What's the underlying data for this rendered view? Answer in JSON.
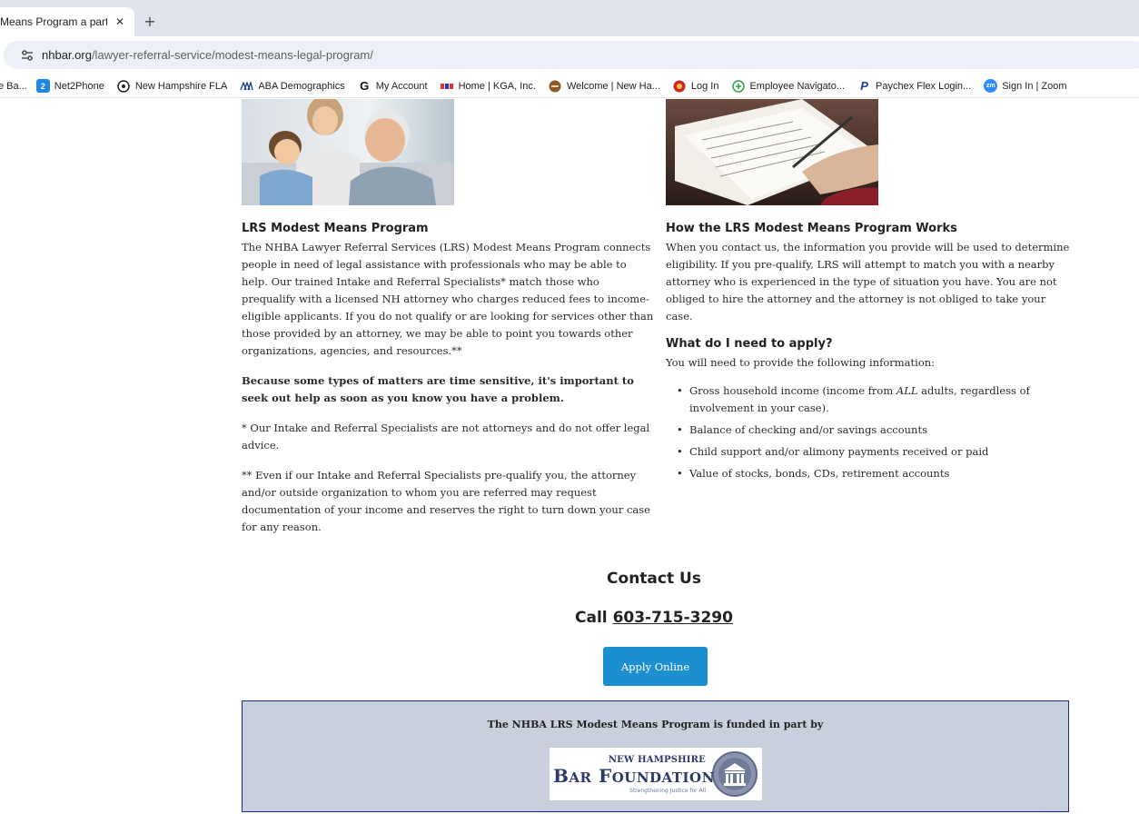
{
  "browser": {
    "tab_title": "Means Program a part",
    "tab_close": "✕",
    "new_tab": "+",
    "url_host": "nhbar.org",
    "url_path": "/lawyer-referral-service/modest-means-legal-program/"
  },
  "bookmarks": [
    {
      "label": "e Ba...",
      "icon": "none"
    },
    {
      "label": "Net2Phone",
      "icon": "2",
      "color": "#1e88e5"
    },
    {
      "label": "New Hampshire FLA",
      "icon": "circle-logo-icon"
    },
    {
      "label": "ABA Demographics",
      "icon": "aba-logo-icon"
    },
    {
      "label": "My Account",
      "icon": "G",
      "color": "#1a1a1a"
    },
    {
      "label": "Home | KGA, Inc.",
      "icon": "kga-logo-icon"
    },
    {
      "label": "Welcome | New Ha...",
      "icon": "brown-circle-icon"
    },
    {
      "label": "Log In",
      "icon": "red-circle-icon"
    },
    {
      "label": "Employee Navigato...",
      "icon": "green-plus-icon"
    },
    {
      "label": "Paychex Flex Login...",
      "icon": "P"
    },
    {
      "label": "Sign In | Zoom",
      "icon": "zm"
    }
  ],
  "left": {
    "heading": "LRS Modest Means Program",
    "para1": "The NHBA Lawyer Referral Services (LRS) Modest Means Program connects people in need of legal assistance with professionals who may be able to help. Our trained Intake and Referral Specialists* match those who prequalify with a licensed NH attorney who charges reduced fees to income-eligible applicants. If you do not qualify or are looking for services other than those provided by an attorney, we may be able to point you towards other organizations, agencies, and resources.**",
    "para2": "Because some types of matters are time sensitive, it's important to seek out help as soon as you know you have a problem.",
    "para3": "* Our Intake and Referral Specialists are not attorneys and do not offer legal advice.",
    "para4": "** Even if our Intake and Referral Specialists pre-qualify you, the attorney and/or outside organization to whom you are referred may request documentation of your income and reserves the right to turn down your case for any reason."
  },
  "right": {
    "heading": "How the LRS Modest Means Program Works",
    "para1": "When you contact us, the information you provide will be used to determine eligibility. If you pre-qualify, LRS will attempt to match you with a nearby attorney who is experienced in the type of situation you have. You are not obliged to hire the attorney and the attorney is not obliged to take your case.",
    "heading2": "What do I need to apply?",
    "para2": "You will need to provide the following information:",
    "item1_pre": "Gross household income (income from ",
    "item1_em": "ALL",
    "item1_post": " adults, regardless of involvement in your case).",
    "item2": "Balance of checking and/or savings accounts",
    "item3": "Child support and/or alimony payments received or paid",
    "item4": "Value of stocks, bonds, CDs, retirement accounts"
  },
  "contact": {
    "title": "Contact Us",
    "call_prefix": "Call ",
    "phone": "603-715-3290",
    "apply_label": "Apply Online"
  },
  "funding": {
    "text": "The NHBA LRS Modest Means Program is funded in part by",
    "logo_top": "NEW HAMPSHIRE",
    "logo_main_b": "B",
    "logo_main_ar": "AR",
    "logo_main_f": "F",
    "logo_main_oundation": "OUNDATION",
    "logo_tagline": "Strengthening Justice for All"
  },
  "colors": {
    "apply_button": "#1c8fd1",
    "funded_box_bg": "#c7d0dc",
    "funded_box_border": "#1a2a8a",
    "logo_navy": "#2c3a6b"
  }
}
